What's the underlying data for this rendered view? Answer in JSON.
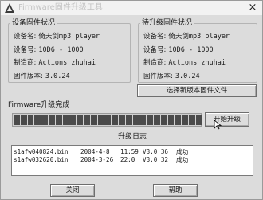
{
  "window": {
    "title": "Firmware固件升级工具",
    "close_glyph": "×"
  },
  "device_panel": {
    "title": "设备固件状况",
    "rows": [
      {
        "label": "设备名:",
        "value": "倚天剑mp3 player"
      },
      {
        "label": "设备号:",
        "value": "10D6 - 1000"
      },
      {
        "label": "制造商:",
        "value": "Actions zhuhai"
      },
      {
        "label": "固件版本:",
        "value": "3.0.24"
      }
    ]
  },
  "upgrade_panel": {
    "title": "待升级固件状况",
    "rows": [
      {
        "label": "设备名:",
        "value": "倚天剑mp3 player"
      },
      {
        "label": "设备号:",
        "value": "10D6 - 1000"
      },
      {
        "label": "制造商:",
        "value": "Actions zhuhai"
      },
      {
        "label": "固件版本:",
        "value": "3.0.24"
      }
    ]
  },
  "select_button_label": "选择新版本固件文件",
  "status_text": "Firmware升级完成",
  "progress": {
    "value": 1.0,
    "segments": 27
  },
  "start_button_label": "开始升级",
  "log": {
    "title": "升级日志",
    "entries": [
      {
        "file": "s1afw040824.bin",
        "date": "2004-4-8",
        "time": "11:59",
        "version": "V3.0.36",
        "result": "成功"
      },
      {
        "file": "s1afw032620.bin",
        "date": "2004-3-26",
        "time": "22:0",
        "version": "V3.0.32",
        "result": "成功"
      }
    ]
  },
  "close_button_label": "关闭",
  "help_button_label": "帮助",
  "colors": {
    "window_bg": "#dcdcdc",
    "progress_fill": "#4a4a4a"
  }
}
